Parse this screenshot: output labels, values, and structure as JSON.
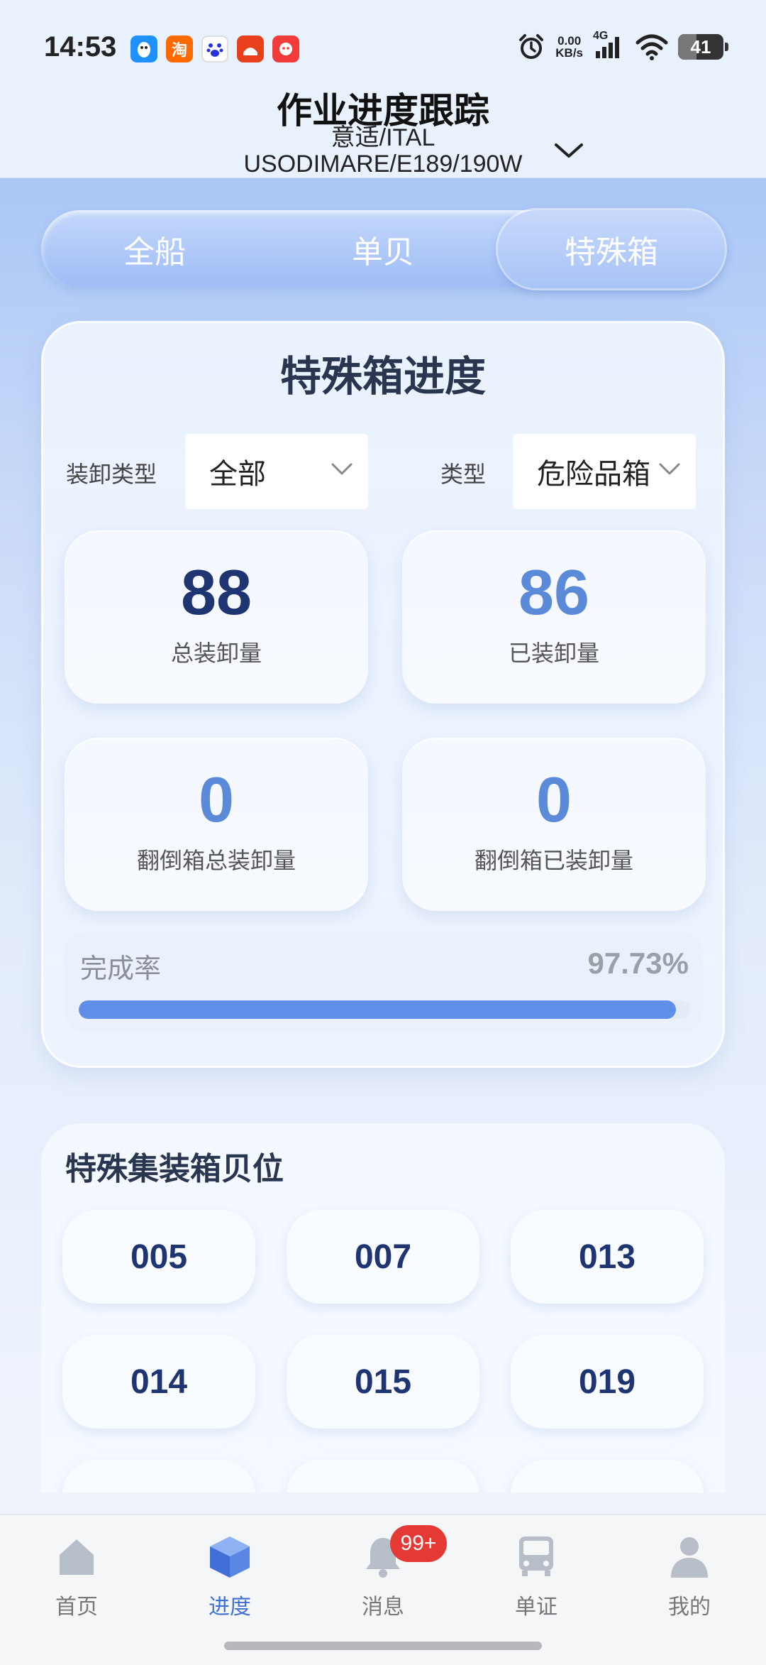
{
  "status_bar": {
    "time": "14:53",
    "net_speed_value": "0.00",
    "net_speed_unit": "KB/s",
    "network": "4G",
    "battery": "41",
    "battery_level": 0.41,
    "app_icons": [
      "qq-icon",
      "taobao-icon",
      "baidu-icon",
      "app-icon",
      "app-icon"
    ]
  },
  "header": {
    "title": "作业进度跟踪",
    "subtitle_line1": "意适/ITAL",
    "subtitle_line2": "USODIMARE/E189/190W"
  },
  "tabs": [
    {
      "label": "全船",
      "active": false
    },
    {
      "label": "单贝",
      "active": false
    },
    {
      "label": "特殊箱",
      "active": true
    }
  ],
  "progress_card": {
    "title": "特殊箱进度",
    "filters": {
      "load_type_label": "装卸类型",
      "load_type_value": "全部",
      "type_label": "类型",
      "type_value": "危险品箱"
    },
    "stats": [
      {
        "value": "88",
        "label": "总装卸量"
      },
      {
        "value": "86",
        "label": "已装卸量"
      },
      {
        "value": "0",
        "label": "翻倒箱总装卸量"
      },
      {
        "value": "0",
        "label": "翻倒箱已装卸量"
      }
    ],
    "completion": {
      "label": "完成率",
      "value": "97.73%",
      "fraction": 0.9773
    }
  },
  "bay_section": {
    "title": "特殊集装箱贝位",
    "bays": [
      "005",
      "007",
      "013",
      "014",
      "015",
      "019"
    ]
  },
  "bottom_nav": [
    {
      "label": "首页",
      "icon": "home-icon",
      "active": false
    },
    {
      "label": "进度",
      "icon": "cube-icon",
      "active": true
    },
    {
      "label": "消息",
      "icon": "bell-icon",
      "active": false,
      "badge": "99+"
    },
    {
      "label": "单证",
      "icon": "bus-icon",
      "active": false
    },
    {
      "label": "我的",
      "icon": "user-icon",
      "active": false
    }
  ],
  "colors": {
    "accent": "#5f8fe8",
    "dark_value": "#1f3572",
    "light_value": "#5b8ad8",
    "badge": "#e53935"
  }
}
